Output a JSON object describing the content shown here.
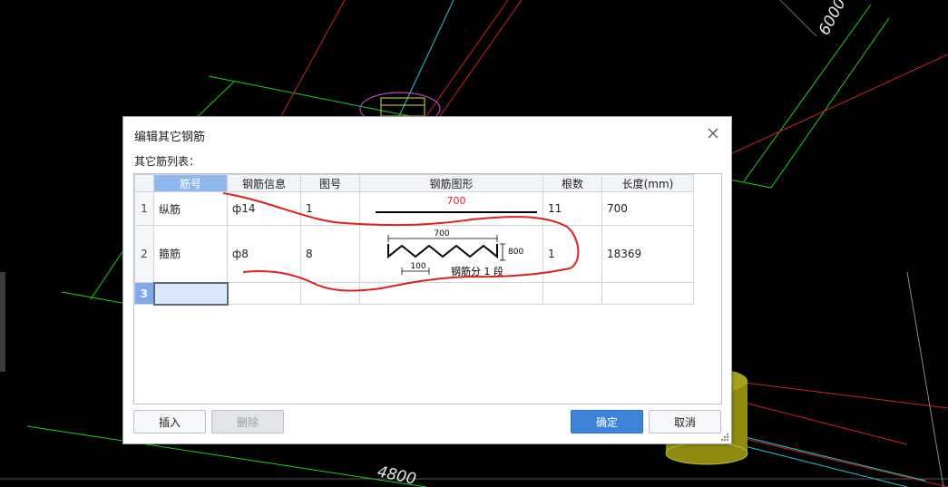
{
  "cad": {
    "dim_top_right": "6000",
    "dim_bottom": "4800"
  },
  "dialog": {
    "title": "编辑其它钢筋",
    "list_label": "其它筋列表：",
    "columns": [
      "筋号",
      "钢筋信息",
      "图号",
      "钢筋图形",
      "根数",
      "长度(mm)"
    ],
    "rows": [
      {
        "num": "1",
        "name": "纵筋",
        "info": "ф14",
        "fig": "1",
        "count": "11",
        "length": "700",
        "shape": {
          "dim": "700"
        }
      },
      {
        "num": "2",
        "name": "箍筋",
        "info": "ф8",
        "fig": "8",
        "count": "1",
        "length": "18369",
        "shape": {
          "dim_top": "700",
          "dim_right": "800",
          "dim_bottom": "100",
          "note": "钢筋分  1  段"
        }
      },
      {
        "num": "3",
        "name": "",
        "info": "",
        "fig": "",
        "count": "",
        "length": ""
      }
    ],
    "buttons": {
      "insert": "插入",
      "delete": "删除",
      "ok": "确定",
      "cancel": "取消"
    },
    "close_icon": "close-icon",
    "colors": {
      "accent": "#3d84d8",
      "header_selected": "#8fb8ec",
      "annotation": "#e0201c"
    }
  }
}
